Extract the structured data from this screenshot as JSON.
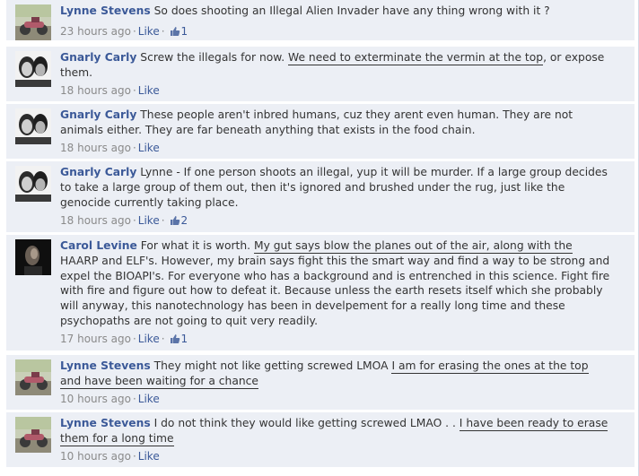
{
  "comments": [
    {
      "author": "Lynne Stevens",
      "avatar": "motorcycle-photo",
      "text_parts": [
        {
          "t": "So does shooting an Illegal Alien Invader have any thing wrong with it ?",
          "u": false
        }
      ],
      "time": "23 hours ago",
      "like_label": "Like",
      "like_count": "1"
    },
    {
      "author": "Gnarly Carly",
      "avatar": "couple-photo",
      "text_parts": [
        {
          "t": "Screw the illegals for now. ",
          "u": false
        },
        {
          "t": "We need to exterminate the vermin at the top",
          "u": true
        },
        {
          "t": ", or expose them.",
          "u": false
        }
      ],
      "time": "18 hours ago",
      "like_label": "Like",
      "like_count": ""
    },
    {
      "author": "Gnarly Carly",
      "avatar": "couple-photo",
      "text_parts": [
        {
          "t": "These people aren't inbred humans, cuz they arent even human. They are not animals either. They are far beneath anything that exists in the food chain.",
          "u": false
        }
      ],
      "time": "18 hours ago",
      "like_label": "Like",
      "like_count": ""
    },
    {
      "author": "Gnarly Carly",
      "avatar": "couple-photo",
      "text_parts": [
        {
          "t": "Lynne - If one person shoots an illegal, yup it will be murder. If a large group decides to take a large group of them out, then it's ignored and brushed under the rug, just like the genocide currently taking place.",
          "u": false
        }
      ],
      "time": "18 hours ago",
      "like_label": "Like",
      "like_count": "2"
    },
    {
      "author": "Carol Levine",
      "avatar": "dark-portrait-photo",
      "text_parts": [
        {
          "t": "For what it is worth. ",
          "u": false
        },
        {
          "t": "My gut says blow the planes out of the air, along with the",
          "u": true
        },
        {
          "t": " HAARP and ELF's. However, my brain says fight this the smart way and find a way to be strong and expel the BIOAPI's. For everyone who has a background and is entrenched in this science. Fight fire with fire and figure out how to defeat it. Because unless the earth resets itself which she probably will anyway, this nanotechnology has been in develpement for a really long time and these psychopaths are not going to quit very readily.",
          "u": false
        }
      ],
      "time": "17 hours ago",
      "like_label": "Like",
      "like_count": "1"
    },
    {
      "author": "Lynne Stevens",
      "avatar": "motorcycle-photo",
      "text_parts": [
        {
          "t": "They might not like getting screwed LMOA ",
          "u": false
        },
        {
          "t": "I am for erasing the ones at the top and have been waiting for a chance",
          "u": true
        }
      ],
      "time": "10 hours ago",
      "like_label": "Like",
      "like_count": ""
    },
    {
      "author": "Lynne Stevens",
      "avatar": "motorcycle-photo",
      "text_parts": [
        {
          "t": "I do not think they would like getting screwed LMAO . . ",
          "u": false
        },
        {
          "t": "I have been ready to erase them for a long time",
          "u": true
        }
      ],
      "time": "10 hours ago",
      "like_label": "Like",
      "like_count": ""
    }
  ],
  "colors": {
    "name": "#3b5998",
    "bg": "#eceff5",
    "meta": "#8a8a8a"
  }
}
